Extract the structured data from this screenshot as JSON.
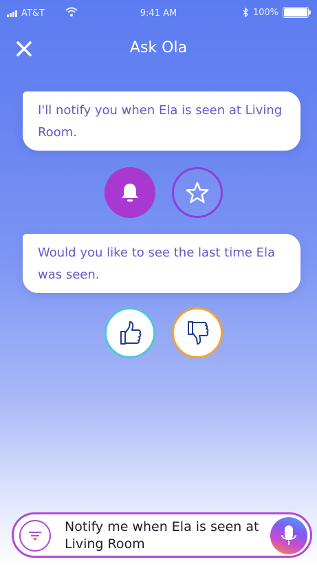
{
  "status_bar": {
    "carrier": "AT&T",
    "time": "9:41 AM",
    "battery": "100%"
  },
  "header": {
    "title": "Ask Ola"
  },
  "messages": [
    {
      "text": "I'll notify you when Ela is seen at Living Room."
    },
    {
      "text": "Would you like to see the last time Ela was seen."
    }
  ],
  "input": {
    "value": "Notify me when Ela is seen at Living Room"
  },
  "icons": {
    "close": "close-icon",
    "bell": "bell-icon",
    "star": "star-icon",
    "thumbs_up": "thumbs-up-icon",
    "thumbs_down": "thumbs-down-icon",
    "filter": "filter-icon",
    "mic": "microphone-icon"
  },
  "colors": {
    "accent_purple": "#a838d0",
    "bubble_text": "#6a55c9",
    "thumbs_up_ring": "#4fc7d8",
    "thumbs_down_ring": "#f0a43a"
  }
}
